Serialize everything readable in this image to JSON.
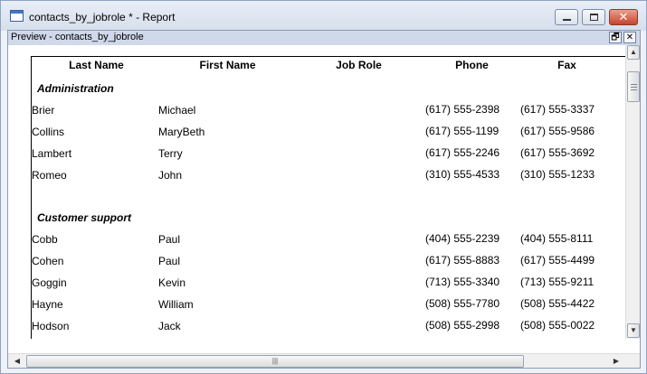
{
  "window": {
    "title": "contacts_by_jobrole * - Report",
    "minimize_glyph": "",
    "close_glyph": "✕"
  },
  "child": {
    "title": "Preview - contacts_by_jobrole",
    "restore_glyph": "🗗",
    "close_glyph": "✕"
  },
  "report": {
    "columns": [
      "Last Name",
      "First Name",
      "Job Role",
      "Phone",
      "Fax"
    ],
    "groups": [
      {
        "name": "Administration",
        "rows": [
          {
            "last": "Brier",
            "first": "Michael",
            "phone": "(617) 555-2398",
            "fax": "(617) 555-3337"
          },
          {
            "last": "Collins",
            "first": "MaryBeth",
            "phone": "(617) 555-1199",
            "fax": "(617) 555-9586"
          },
          {
            "last": "Lambert",
            "first": "Terry",
            "phone": "(617) 555-2246",
            "fax": "(617) 555-3692"
          },
          {
            "last": "Romeo",
            "first": "John",
            "phone": "(310) 555-4533",
            "fax": "(310) 555-1233"
          }
        ]
      },
      {
        "name": "Customer support",
        "rows": [
          {
            "last": "Cobb",
            "first": "Paul",
            "phone": "(404) 555-2239",
            "fax": "(404) 555-8111"
          },
          {
            "last": "Cohen",
            "first": "Paul",
            "phone": "(617) 555-8883",
            "fax": "(617) 555-4499"
          },
          {
            "last": "Goggin",
            "first": "Kevin",
            "phone": "(713) 555-3340",
            "fax": "(713) 555-9211"
          },
          {
            "last": "Hayne",
            "first": "William",
            "phone": "(508) 555-7780",
            "fax": "(508) 555-4422"
          },
          {
            "last": "Hodson",
            "first": "Jack",
            "phone": "(508) 555-2998",
            "fax": "(508) 555-0022"
          }
        ]
      }
    ]
  },
  "scrollbars": {
    "up_arrow": "▲",
    "down_arrow": "▼",
    "left_arrow": "◀",
    "right_arrow": "▶",
    "h_grip": "|||"
  }
}
